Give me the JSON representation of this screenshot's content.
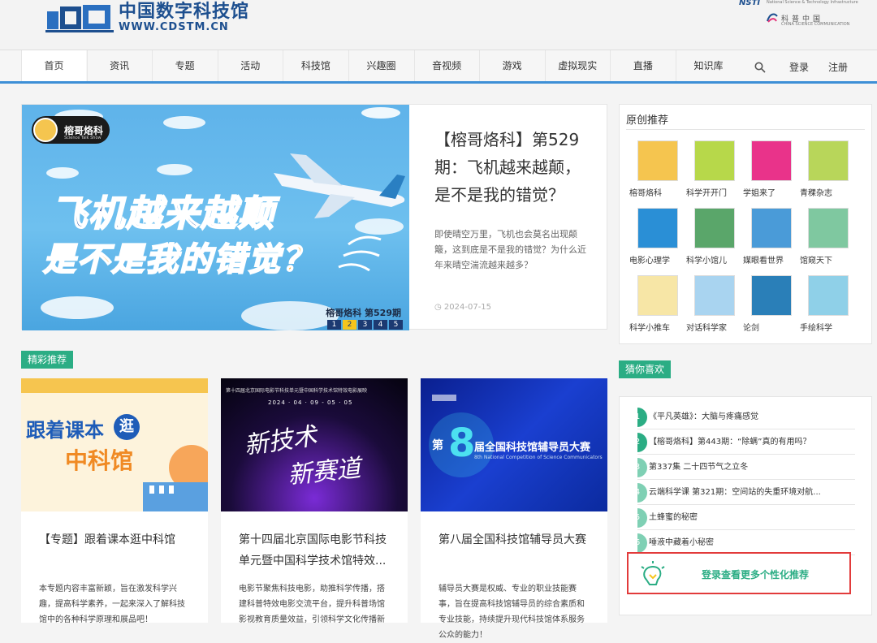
{
  "brand": {
    "logo_cn": "中国数字科技馆",
    "logo_en": "WWW.CDSTM.CN"
  },
  "partner": {
    "nsti": "NSTI",
    "nsti_sub": "National Science & Technology Infrastructure",
    "cn": "科普中国",
    "en": "CHINA SCIENCE COMMUNICATION"
  },
  "nav": {
    "items": [
      {
        "label": "首页",
        "color": "#e4347a"
      },
      {
        "label": "资讯",
        "color": "#f6a623"
      },
      {
        "label": "专题",
        "color": "#7fbf3a"
      },
      {
        "label": "活动",
        "color": "#f08a24"
      },
      {
        "label": "科技馆",
        "color": "#3aa6dd"
      },
      {
        "label": "兴趣圈",
        "color": "#8a5cc9"
      },
      {
        "label": "音视频",
        "color": "#29b6a5"
      },
      {
        "label": "游戏",
        "color": "#f6a623"
      },
      {
        "label": "虚拟现实",
        "color": "#e4347a"
      },
      {
        "label": "直播",
        "color": "#3aa6dd"
      },
      {
        "label": "知识库",
        "color": "#7fbf3a"
      }
    ],
    "login": "登录",
    "register": "注册",
    "search_icon": "search-icon"
  },
  "hero": {
    "badge": "榕哥烙科",
    "badge_sub": "Science Talk Show",
    "image_title1": "飞机越来越颠",
    "image_title2": "是不是我的错觉？",
    "caption": "榕哥烙科 第529期",
    "pages": [
      "1",
      "2",
      "3",
      "4",
      "5"
    ],
    "active_page": 2,
    "headline": "【榕哥烙科】第529期：飞机越来越颠，是不是我的错觉？",
    "desc": "即使晴空万里，飞机也会莫名出现颠簸，这到底是不是我的错觉？为什么近年来晴空湍流越来越多？",
    "date": "2024-07-15"
  },
  "featured": {
    "tag": "精彩推荐",
    "cards": [
      {
        "img_line1": "跟着课本",
        "img_badge": "逛",
        "img_line2": "中科馆",
        "title": "【专题】跟着课本逛中科馆",
        "desc": "本专题内容丰富新颖，旨在激发科学兴趣，提高科学素养，一起来深入了解科技馆中的各种科学原理和展品吧！"
      },
      {
        "img_banner": "第十四届北京国际电影节科技单元暨中国科学技术馆特效电影展映",
        "img_dates": "2024 · 04 · 09 - 05 · 05",
        "img_line1": "新技术",
        "img_line2": "新赛道",
        "title": "第十四届北京国际电影节科技单元暨中国科学技术馆特效...",
        "desc": "电影节聚焦科技电影，助推科学传播，搭建科普特效电影交流平台，提升科普场馆影视教育质量效益，引领科学文化传播新"
      },
      {
        "img_big": "8",
        "img_pre": "第",
        "img_line1": "届全国科技馆辅导员大赛",
        "img_sub": "8th National Competition of Science Communicators",
        "title": "第八届全国科技馆辅导员大赛",
        "desc": "辅导员大赛是权威、专业的职业技能赛事，旨在提高科技馆辅导员的综合素质和专业技能，持续提升现代科技馆体系服务公众的能力！"
      }
    ]
  },
  "original": {
    "title": "原创推荐",
    "items": [
      {
        "label": "榕哥烙科",
        "icon": "face-icon",
        "color": "#f5c54f"
      },
      {
        "label": "科学开开门",
        "icon": "door-icon",
        "color": "#b7d84a"
      },
      {
        "label": "学姐来了",
        "icon": "girl-icon",
        "color": "#e9338a"
      },
      {
        "label": "青稞杂志",
        "icon": "magazine-icon",
        "color": "#b8d65a"
      },
      {
        "label": "电影心理学",
        "icon": "film-icon",
        "color": "#2a8fd6"
      },
      {
        "label": "科学小馆儿",
        "icon": "pot-icon",
        "color": "#5aa66a"
      },
      {
        "label": "媒眼看世界",
        "icon": "eye-icon",
        "color": "#4a9bd8"
      },
      {
        "label": "馆窥天下",
        "icon": "window-icon",
        "color": "#7fc8a0"
      },
      {
        "label": "科学小推车",
        "icon": "bulb-icon",
        "color": "#f7e6a6"
      },
      {
        "label": "对话科学家",
        "icon": "scientist-icon",
        "color": "#a9d4f0"
      },
      {
        "label": "论剑",
        "icon": "sword-icon",
        "color": "#2a7fb8"
      },
      {
        "label": "手绘科学",
        "icon": "flask-icon",
        "color": "#8fd0e8"
      }
    ]
  },
  "guess": {
    "tag": "猜你喜欢",
    "items": [
      {
        "num": "1",
        "text": "《平凡英雄》：大脑与疼痛感觉"
      },
      {
        "num": "2",
        "text": "【榕哥烙科】第443期：“除螨”真的有用吗？"
      },
      {
        "num": "3",
        "text": "第337集 二十四节气之立冬"
      },
      {
        "num": "4",
        "text": "云端科学课 第321期：空间站的失重环境对航..."
      },
      {
        "num": "5",
        "text": "土蜂蜜的秘密"
      },
      {
        "num": "6",
        "text": "唾液中藏着小秘密"
      }
    ],
    "login_text": "登录查看更多个性化推荐"
  }
}
